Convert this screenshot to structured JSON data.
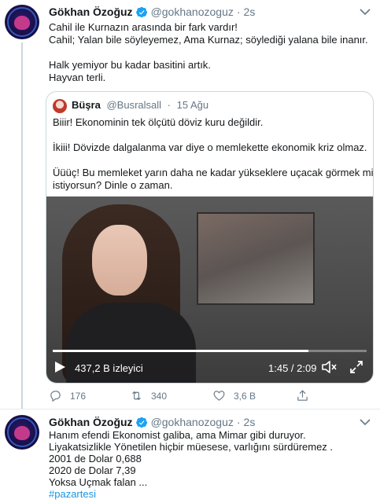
{
  "tweet1": {
    "name": "Gökhan Özoğuz",
    "handle": "@gokhanozoguz",
    "dot": "·",
    "time": "2s",
    "lines": [
      "Cahil ile Kurnazın arasında bir fark vardır!",
      "Cahil; Yalan bile söyleyemez, Ama Kurnaz; söylediği yalana bile inanır.",
      "Halk yemiyor bu kadar basitini artık.",
      "Hayvan terli."
    ],
    "quote": {
      "name": "Büşra",
      "handle": "@Busralsall",
      "dot": "·",
      "time": "15 Ağu",
      "lines": [
        "Biiir! Ekonominin tek ölçütü döviz kuru değildir.",
        "İkiii! Dövizde dalgalanma var diye o memlekette ekonomik kriz olmaz.",
        "Üüüç! Bu memleket yarın daha ne kadar yükseklere uçacak görmek mi",
        "istiyorsun? Dinle o zaman."
      ],
      "video": {
        "views": "437,2 B izleyici",
        "time": "1:45 / 2:09",
        "progress": 0.814
      }
    },
    "actions": {
      "reply_count": "176",
      "retweet_count": "340",
      "like_count": "3,6 B"
    }
  },
  "tweet2": {
    "name": "Gökhan Özoğuz",
    "handle": "@gokhanozoguz",
    "dot": "·",
    "time": "2s",
    "lines": [
      "Hanım efendi Ekonomist galiba, ama Mimar gibi duruyor.",
      "Liyakatsizlikle Yönetilen hiçbir müesese, varlığını sürdüremez .",
      "2001 de Dolar 0,688",
      "2020 de Dolar 7,39",
      "Yoksa Uçmak falan ..."
    ],
    "hashtag": "#pazartesi"
  },
  "colors": {
    "accent": "#1da1f2",
    "link": "#1b95e0",
    "muted": "#657786"
  }
}
